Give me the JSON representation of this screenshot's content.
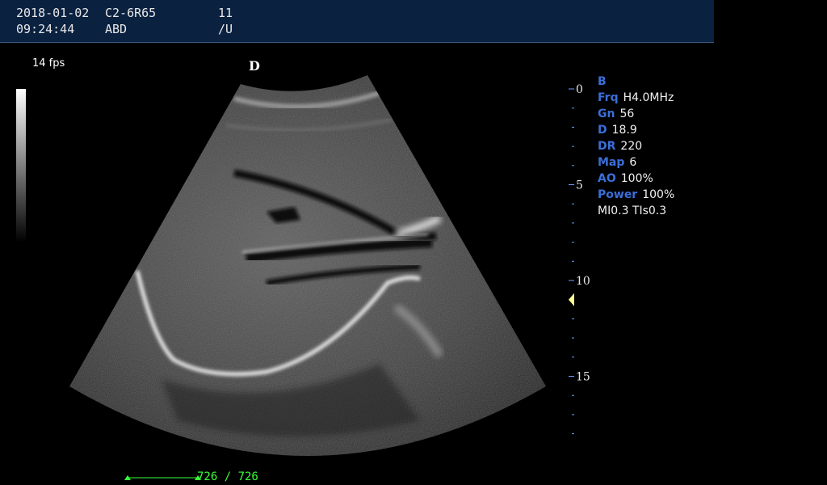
{
  "header": {
    "date": "2018-01-02",
    "probe": "C2-6R65",
    "frame_num": "11",
    "time": "09:24:44",
    "exam": "ABD",
    "unit": "/U"
  },
  "image": {
    "fps_label": "14 fps",
    "orientation_mark": "D"
  },
  "depth_scale": {
    "labels": [
      "0",
      "5",
      "10",
      "15"
    ],
    "focus_depth": 11
  },
  "params": [
    {
      "key": "B",
      "value": ""
    },
    {
      "key": "Frq",
      "value": "H4.0MHz"
    },
    {
      "key": "Gn",
      "value": "56"
    },
    {
      "key": "D",
      "value": "18.9"
    },
    {
      "key": "DR",
      "value": "220"
    },
    {
      "key": "Map",
      "value": "6"
    },
    {
      "key": "AO",
      "value": "100%"
    },
    {
      "key": "Power",
      "value": "100%"
    }
  ],
  "mi_ti": "MI0.3 TIs0.3",
  "cine": {
    "label": "726 / 726",
    "position": 726,
    "total": 726
  },
  "colors": {
    "header_bg": "#0a2140",
    "param_key": "#3a6fd8",
    "cine_green": "#38ff38",
    "focus_marker": "#ffff99"
  }
}
